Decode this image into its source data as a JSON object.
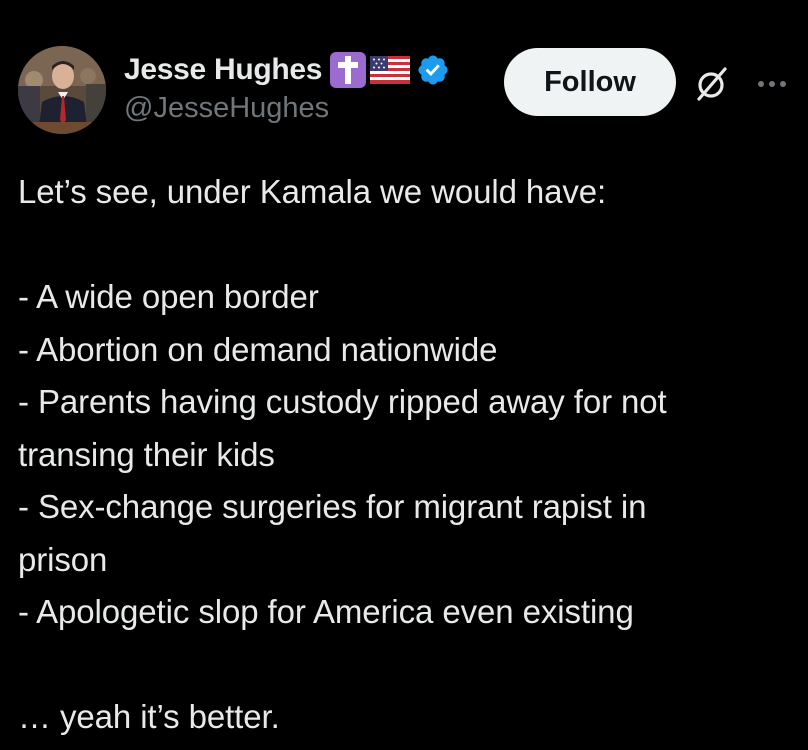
{
  "author": {
    "display_name": "Jesse Hughes",
    "handle": "@JesseHughes",
    "badges": [
      "latin-cross-emoji",
      "us-flag-emoji",
      "verified-badge-icon"
    ],
    "verified_color": "#1d9bf0"
  },
  "actions": {
    "follow_label": "Follow",
    "grok_icon": "grok-icon",
    "more_icon": "more-options-icon"
  },
  "post": {
    "intro": "Let’s see, under Kamala we would have:",
    "list": [
      {
        "lines": [
          "- A wide open border"
        ]
      },
      {
        "lines": [
          "- Abortion on demand nationwide"
        ]
      },
      {
        "lines": [
          "- Parents having custody ripped away for not",
          "transing their kids"
        ]
      },
      {
        "lines": [
          "- Sex-change surgeries for migrant rapist in",
          "prison"
        ]
      },
      {
        "lines": [
          "- Apologetic slop for America even existing"
        ]
      }
    ],
    "closing": "… yeah it’s better."
  },
  "colors": {
    "background": "#000000",
    "text_primary": "#e7e9ea",
    "text_secondary": "#71767b",
    "follow_bg": "#eff3f4",
    "follow_text": "#0f1419",
    "cross_emoji_bg": "#9b6bd0"
  }
}
